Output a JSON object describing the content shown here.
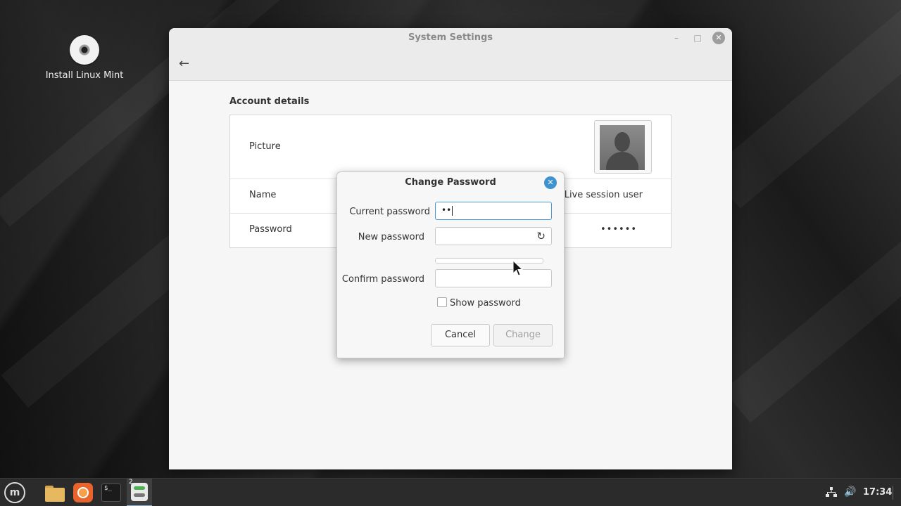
{
  "desktop": {
    "icons": [
      {
        "label": "Install Linux Mint",
        "icon": "disc-icon"
      }
    ]
  },
  "window": {
    "title": "System Settings",
    "back_icon": "arrow-left-icon",
    "controls": {
      "minimize": "–",
      "maximize": "□",
      "close": "✕"
    }
  },
  "account": {
    "section_title": "Account details",
    "rows": [
      {
        "label": "Picture",
        "value": ""
      },
      {
        "label": "Name",
        "value": "Live session user"
      },
      {
        "label": "Password",
        "value": "••••••"
      }
    ]
  },
  "dialog": {
    "title": "Change Password",
    "close_icon": "close-icon",
    "fields": {
      "current_password": {
        "label": "Current password",
        "value": "••"
      },
      "new_password": {
        "label": "New password",
        "value": "",
        "icon": "refresh-icon"
      },
      "confirm_password": {
        "label": "Confirm password",
        "value": ""
      }
    },
    "show_password": {
      "label": "Show password",
      "checked": false
    },
    "buttons": {
      "cancel": "Cancel",
      "change": "Change"
    }
  },
  "taskbar": {
    "apps": [
      "menu-icon",
      "files-icon",
      "firefox-icon",
      "terminal-icon",
      "settings-icon"
    ],
    "terminal_glyph": "$_",
    "settings_badge": "2",
    "clock": "17:34",
    "tray": [
      "network-icon",
      "volume-icon"
    ]
  },
  "colors": {
    "accent": "#3d93d0",
    "focus_border": "#4a9ad6",
    "taskbar": "#2b2b2b"
  }
}
